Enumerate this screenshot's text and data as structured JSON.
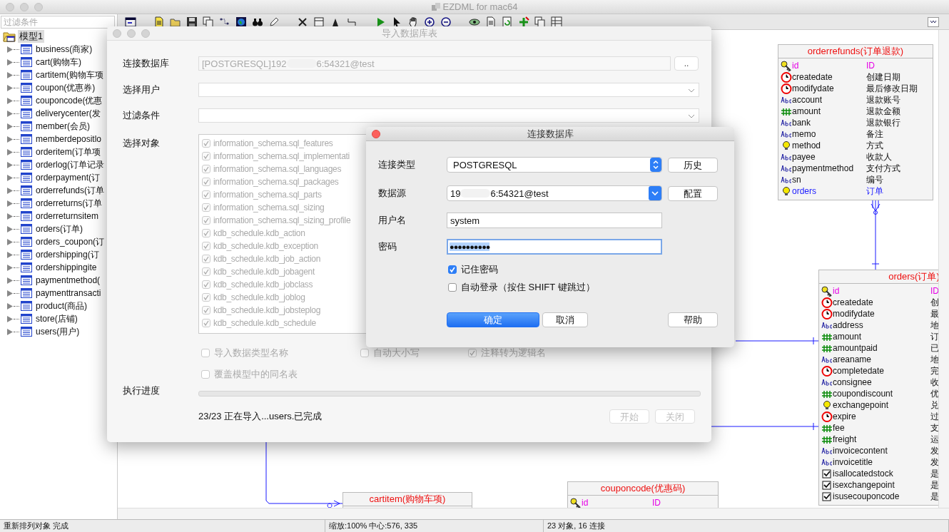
{
  "window": {
    "title": "EZDML for mac64"
  },
  "sidebar": {
    "filter_placeholder": "过滤条件",
    "model": {
      "label": "模型1",
      "selected": true,
      "expanded": true,
      "children": [
        {
          "label": "business(商家)",
          "selected": false,
          "expanded": false
        },
        {
          "label": "cart(购物车)",
          "selected": false,
          "expanded": false
        },
        {
          "label": "cartitem(购物车项",
          "selected": false,
          "expanded": false
        },
        {
          "label": "coupon(优惠券)",
          "selected": false,
          "expanded": false
        },
        {
          "label": "couponcode(优惠",
          "selected": false,
          "expanded": false
        },
        {
          "label": "deliverycenter(发",
          "selected": false,
          "expanded": false
        },
        {
          "label": "member(会员)",
          "selected": false,
          "expanded": false
        },
        {
          "label": "memberdepositlo",
          "selected": false,
          "expanded": false
        },
        {
          "label": "orderitem(订单项",
          "selected": false,
          "expanded": false
        },
        {
          "label": "orderlog(订单记录",
          "selected": false,
          "expanded": false
        },
        {
          "label": "orderpayment(订",
          "selected": false,
          "expanded": false
        },
        {
          "label": "orderrefunds(订单",
          "selected": false,
          "expanded": false
        },
        {
          "label": "orderreturns(订单",
          "selected": false,
          "expanded": false
        },
        {
          "label": "orderreturnsitem",
          "selected": false,
          "expanded": false
        },
        {
          "label": "orders(订单)",
          "selected": false,
          "expanded": false
        },
        {
          "label": "orders_coupon(订",
          "selected": false,
          "expanded": false
        },
        {
          "label": "ordershipping(订",
          "selected": false,
          "expanded": false
        },
        {
          "label": "ordershippingite",
          "selected": false,
          "expanded": false
        },
        {
          "label": "paymentmethod(",
          "selected": false,
          "expanded": false
        },
        {
          "label": "paymenttransacti",
          "selected": false,
          "expanded": false
        },
        {
          "label": "product(商品)",
          "selected": false,
          "expanded": false
        },
        {
          "label": "store(店铺)",
          "selected": false,
          "expanded": false
        },
        {
          "label": "users(用户)",
          "selected": false,
          "expanded": false
        }
      ]
    }
  },
  "tables": [
    {
      "title": "orderrefunds(订单退款)",
      "fields": [
        {
          "kind": "key",
          "name": "id",
          "comment": "ID"
        },
        {
          "kind": "date",
          "name": "createdate",
          "comment": "创建日期"
        },
        {
          "kind": "date",
          "name": "modifydate",
          "comment": "最后修改日期"
        },
        {
          "kind": "text",
          "name": "account",
          "comment": "退款账号"
        },
        {
          "kind": "number",
          "name": "amount",
          "comment": "退款金额"
        },
        {
          "kind": "text",
          "name": "bank",
          "comment": "退款银行"
        },
        {
          "kind": "text",
          "name": "memo",
          "comment": "备注"
        },
        {
          "kind": "int",
          "name": "method",
          "comment": "方式"
        },
        {
          "kind": "text",
          "name": "payee",
          "comment": "收款人"
        },
        {
          "kind": "text",
          "name": "paymentmethod",
          "comment": "支付方式"
        },
        {
          "kind": "text",
          "name": "sn",
          "comment": "编号"
        },
        {
          "kind": "reference",
          "name": "orders",
          "comment": "订单"
        }
      ]
    },
    {
      "title": "cartitem(购物车项)"
    },
    {
      "title": "orders(订单)",
      "fields": [
        {
          "kind": "key",
          "name": "id",
          "comment": "ID"
        },
        {
          "kind": "date",
          "name": "createdate",
          "comment": "创"
        },
        {
          "kind": "date",
          "name": "modifydate",
          "comment": "最"
        },
        {
          "kind": "text",
          "name": "address",
          "comment": "地"
        },
        {
          "kind": "number",
          "name": "amount",
          "comment": "订"
        },
        {
          "kind": "number",
          "name": "amountpaid",
          "comment": "已"
        },
        {
          "kind": "text",
          "name": "areaname",
          "comment": "地"
        },
        {
          "kind": "date",
          "name": "completedate",
          "comment": "完"
        },
        {
          "kind": "text",
          "name": "consignee",
          "comment": "收"
        },
        {
          "kind": "number",
          "name": "coupondiscount",
          "comment": "优"
        },
        {
          "kind": "int",
          "name": "exchangepoint",
          "comment": "兑"
        },
        {
          "kind": "date",
          "name": "expire",
          "comment": "过"
        },
        {
          "kind": "number",
          "name": "fee",
          "comment": "支"
        },
        {
          "kind": "number",
          "name": "freight",
          "comment": "运"
        },
        {
          "kind": "text",
          "name": "invoicecontent",
          "comment": "发"
        },
        {
          "kind": "text",
          "name": "invoicetitle",
          "comment": "发"
        },
        {
          "kind": "bool",
          "name": "isallocatedstock",
          "comment": "是"
        },
        {
          "kind": "bool",
          "name": "isexchangepoint",
          "comment": "是"
        },
        {
          "kind": "bool",
          "name": "isusecouponcode",
          "comment": "是"
        }
      ]
    },
    {
      "title": "couponcode(优惠码)",
      "fields": [
        {
          "kind": "key",
          "name": "id",
          "comment": "ID"
        }
      ]
    }
  ],
  "status_bar": [
    "重新排列对象 完成",
    "缩放:100% 中心:576, 335",
    "23 对象, 16 连接"
  ],
  "import_dialog": {
    "title": "导入数据库表",
    "database_label": "连接数据库",
    "database_value_start": "[POSTGRESQL]192",
    "database_value_end": "6:54321@test",
    "browse_button": "..",
    "user_label": "选择用户",
    "filter_label": "过滤条件",
    "objects_label": "选择对象",
    "objects": [
      {
        "name": "information_schema.sql_features",
        "checked": true
      },
      {
        "name": "information_schema.sql_implementati",
        "checked": true
      },
      {
        "name": "information_schema.sql_languages",
        "checked": true
      },
      {
        "name": "information_schema.sql_packages",
        "checked": true
      },
      {
        "name": "information_schema.sql_parts",
        "checked": true
      },
      {
        "name": "information_schema.sql_sizing",
        "checked": true
      },
      {
        "name": "information_schema.sql_sizing_profile",
        "checked": true
      },
      {
        "name": "kdb_schedule.kdb_action",
        "checked": true
      },
      {
        "name": "kdb_schedule.kdb_exception",
        "checked": true
      },
      {
        "name": "kdb_schedule.kdb_job_action",
        "checked": true
      },
      {
        "name": "kdb_schedule.kdb_jobagent",
        "checked": true
      },
      {
        "name": "kdb_schedule.kdb_jobclass",
        "checked": true
      },
      {
        "name": "kdb_schedule.kdb_joblog",
        "checked": true
      },
      {
        "name": "kdb_schedule.kdb_jobsteplog",
        "checked": true
      },
      {
        "name": "kdb_schedule.kdb_schedule",
        "checked": true
      }
    ],
    "options": [
      {
        "label": "导入数据类型名称",
        "checked": false
      },
      {
        "label": "自动大小写",
        "checked": false
      },
      {
        "label": "注释转为逻辑名",
        "checked": true
      },
      {
        "label": "覆盖模型中的同名表",
        "checked": false
      }
    ],
    "progress_label": "执行进度",
    "progress": {
      "level": 0
    },
    "status": "23/23 正在导入...users.已完成",
    "buttons": [
      {
        "label": "开始",
        "disabled": true
      },
      {
        "label": "关闭",
        "disabled": true
      }
    ]
  },
  "connect_dialog": {
    "title": "连接数据库",
    "type_label": "连接类型",
    "type_value": "POSTGRESQL",
    "history_button": "历史",
    "source_label": "数据源",
    "source_value_start": "19",
    "source_value_end": "6:54321@test",
    "config_button": "配置",
    "user_label": "用户名",
    "user_value": "system",
    "password_label": "密码",
    "password_value": "●●●●●●●●●●",
    "remember": {
      "label": "记住密码",
      "checked": true
    },
    "auto_login": {
      "label": "自动登录（按住 SHIFT 键跳过）",
      "checked": false
    },
    "buttons": [
      {
        "label": "确定",
        "kind": "primary"
      },
      {
        "label": "取消",
        "kind": "normal"
      },
      {
        "label": "帮助",
        "kind": "normal"
      }
    ]
  }
}
